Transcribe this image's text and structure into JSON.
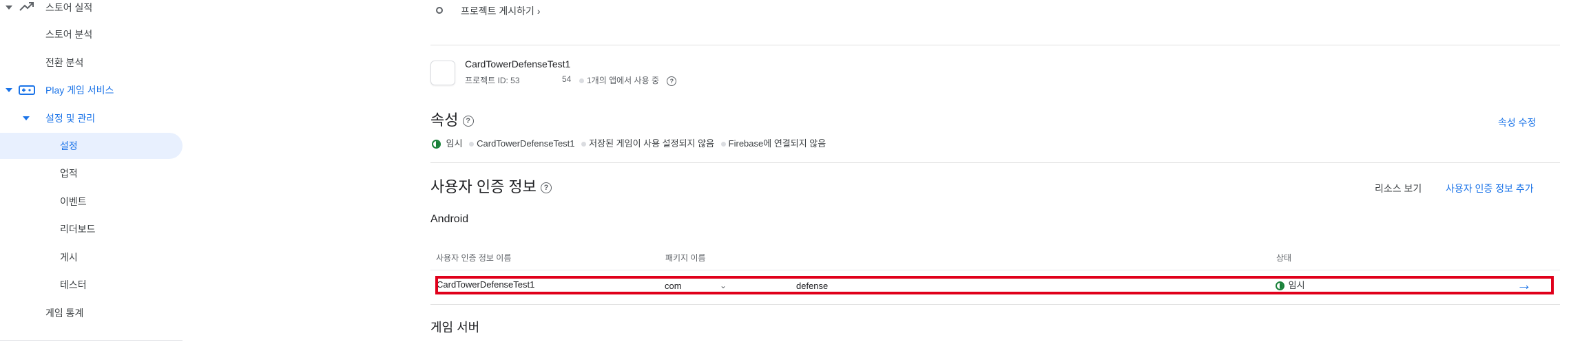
{
  "sidebar": {
    "items": [
      {
        "label": "스토어 실적",
        "icon": "trending-up-icon"
      },
      {
        "label": "스토어 분석"
      },
      {
        "label": "전환 분석"
      },
      {
        "label": "Play 게임 서비스",
        "icon": "gamepad-icon"
      },
      {
        "label": "설정 및 관리"
      },
      {
        "label": "설정"
      },
      {
        "label": "업적"
      },
      {
        "label": "이벤트"
      },
      {
        "label": "리더보드"
      },
      {
        "label": "게시"
      },
      {
        "label": "테스터"
      },
      {
        "label": "게임 통계"
      }
    ]
  },
  "publish": {
    "label": "프로젝트 게시하기",
    "chevron": "›"
  },
  "project": {
    "name": "CardTowerDefenseTest1",
    "id_label": "프로젝트 ID: 53",
    "id_suffix": "54",
    "usage": "1개의 앱에서 사용 중",
    "help": "?"
  },
  "properties": {
    "title": "속성",
    "help": "?",
    "edit_link": "속성 수정",
    "badges": [
      "임시",
      "CardTowerDefenseTest1",
      "저장된 게임이 사용 설정되지 않음",
      "Firebase에 연결되지 않음"
    ]
  },
  "credentials": {
    "title": "사용자 인증 정보",
    "help": "?",
    "view_resources": "리소스 보기",
    "add_link": "사용자 인증 정보 추가",
    "platform": "Android",
    "columns": [
      "사용자 인증 정보 이름",
      "패키지 이름",
      "상태"
    ],
    "row": {
      "name": "CardTowerDefenseTest1",
      "package_start": "com",
      "package_caret": "⌄",
      "package_end": "defense",
      "status": "임시",
      "arrow": "→"
    }
  },
  "game_server": {
    "title": "게임 서버"
  },
  "colors": {
    "accent": "#1a73e8",
    "highlight": "#e0001b",
    "status_green": "#188038"
  }
}
